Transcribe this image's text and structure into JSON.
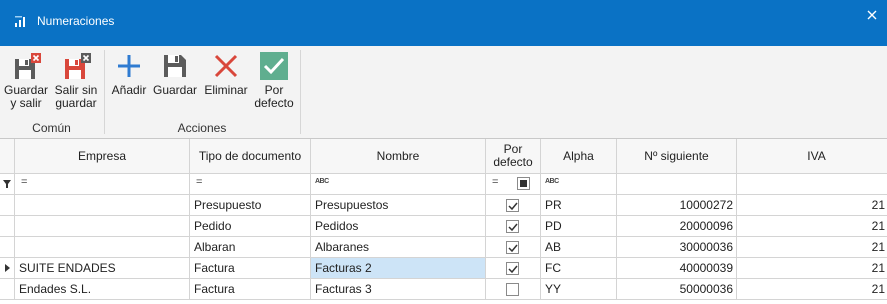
{
  "window": {
    "title": "Numeraciones"
  },
  "ribbon": {
    "groups": [
      {
        "label": "Común"
      },
      {
        "label": "Acciones"
      }
    ],
    "buttons": {
      "save_exit": "Guardar\ny salir",
      "exit_no_save": "Salir sin\nguardar",
      "add": "Añadir",
      "save": "Guardar",
      "delete": "Eliminar",
      "default": "Por\ndefecto"
    }
  },
  "grid": {
    "columns": [
      "Empresa",
      "Tipo de documento",
      "Nombre",
      "Por\ndefecto",
      "Alpha",
      "Nº siguiente",
      "IVA"
    ],
    "rows": [
      {
        "empresa": "",
        "tipo": "Presupuesto",
        "nombre": "Presupuestos",
        "por_defecto": true,
        "alpha": "PR",
        "siguiente": "10000272",
        "iva": "21"
      },
      {
        "empresa": "",
        "tipo": "Pedido",
        "nombre": "Pedidos",
        "por_defecto": true,
        "alpha": "PD",
        "siguiente": "20000096",
        "iva": "21"
      },
      {
        "empresa": "",
        "tipo": "Albaran",
        "nombre": "Albaranes",
        "por_defecto": true,
        "alpha": "AB",
        "siguiente": "30000036",
        "iva": "21"
      },
      {
        "empresa": "SUITE ENDADES",
        "tipo": "Factura",
        "nombre": "Facturas 2",
        "por_defecto": true,
        "alpha": "FC",
        "siguiente": "40000039",
        "iva": "21",
        "current": true
      },
      {
        "empresa": "Endades S.L.",
        "tipo": "Factura",
        "nombre": "Facturas 3",
        "por_defecto": false,
        "alpha": "YY",
        "siguiente": "50000036",
        "iva": "21"
      }
    ]
  },
  "colors": {
    "titlebar": "#0a72c5",
    "selected_cell": "#cde4f7",
    "delete_red": "#d9473b",
    "add_blue": "#2f7bd1",
    "default_green": "#5fae8f"
  }
}
